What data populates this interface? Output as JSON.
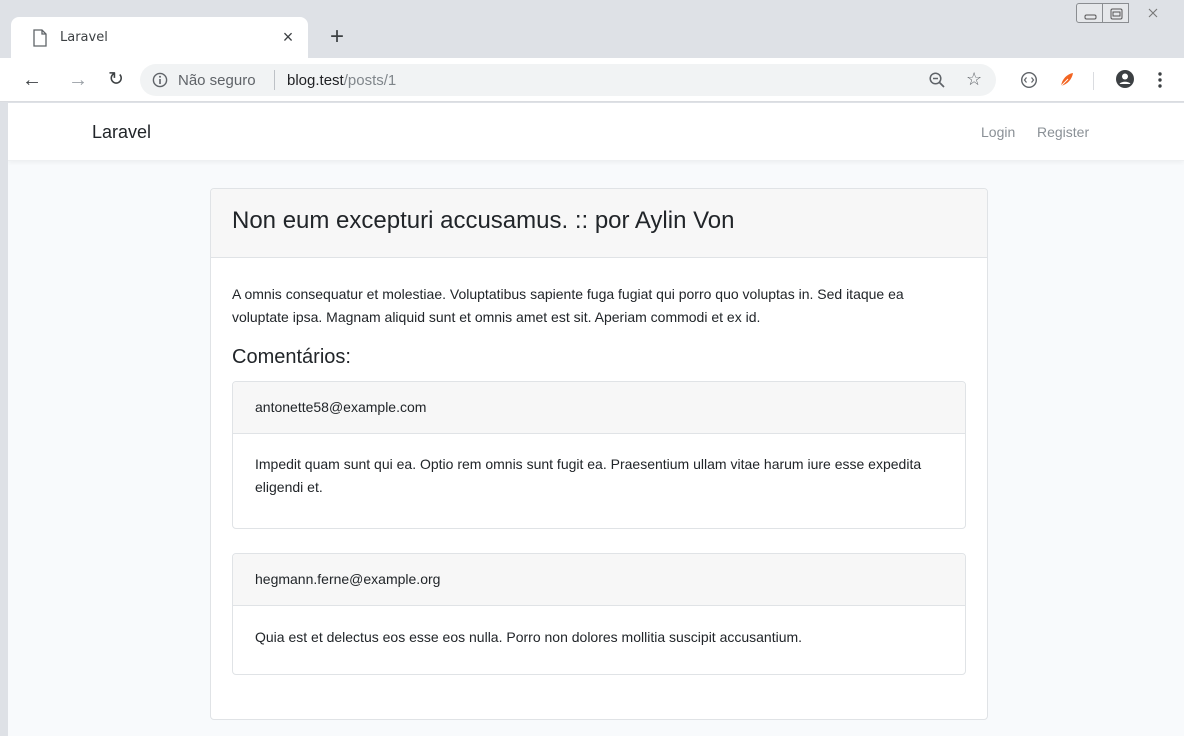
{
  "browser": {
    "tab": {
      "title": "Laravel"
    },
    "new_tab_symbol": "+",
    "close_symbol": "×",
    "address": {
      "security_label": "Não seguro",
      "host": "blog.test",
      "path": "/posts/1"
    },
    "icons": {
      "back": "arrow-left-icon",
      "forward": "arrow-right-icon",
      "reload": "reload-icon",
      "zoom": "zoom-out-icon",
      "bookmark": "star-icon",
      "profile": "account-circle-icon",
      "menu": "vertical-dots-icon"
    }
  },
  "site": {
    "brand": "Laravel",
    "nav": {
      "login": "Login",
      "register": "Register"
    }
  },
  "post": {
    "title": "Non eum excepturi accusamus. :: por Aylin Von",
    "body": "A omnis consequatur et molestiae. Voluptatibus sapiente fuga fugiat qui porro quo voluptas in. Sed itaque ea voluptate ipsa. Magnam aliquid sunt et omnis amet est sit. Aperiam commodi et ex id.",
    "comments_heading": "Comentários:",
    "comments": [
      {
        "email": "antonette58@example.com",
        "body": "Impedit quam sunt qui ea. Optio rem omnis sunt fugit ea. Praesentium ullam vitae harum iure esse expedita eligendi et."
      },
      {
        "email": "hegmann.ferne@example.org",
        "body": "Quia est et delectus eos esse eos nulla. Porro non dolores mollitia suscipit accusantium."
      }
    ]
  },
  "colors": {
    "page_background": "#f8fafc",
    "card_header": "#f7f7f7",
    "chrome_frame": "#dee1e6",
    "extension_accent": "#f26522"
  }
}
